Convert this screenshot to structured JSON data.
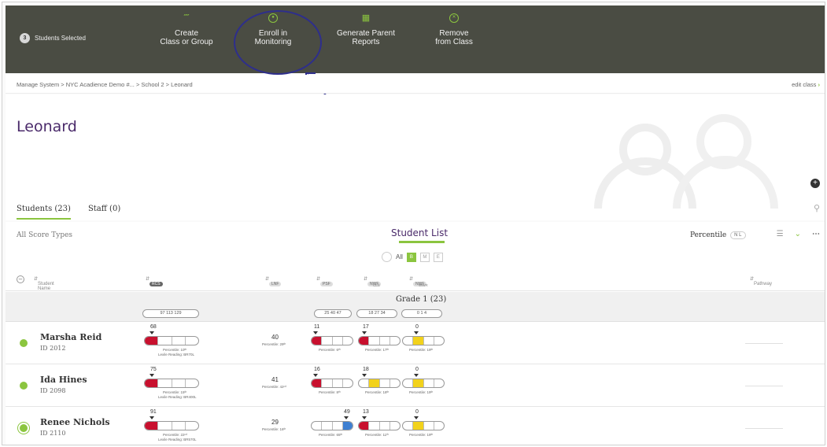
{
  "actionbar": {
    "selected_count": "3",
    "selected_label": "Students Selected",
    "actions": [
      {
        "line1": "Create",
        "line2": "Class or Group",
        "icon": "group-icon"
      },
      {
        "line1": "Enroll in",
        "line2": "Monitoring",
        "icon": "monitoring-icon"
      },
      {
        "line1": "Generate Parent",
        "line2": "Reports",
        "icon": "document-icon"
      },
      {
        "line1": "Remove",
        "line2": "from Class",
        "icon": "remove-icon"
      }
    ]
  },
  "breadcrumb": "Manage System > NYC Acadience Demo #... > School 2 > Leonard",
  "edit_class": "edit class",
  "page_title": "Leonard",
  "tabs": [
    {
      "label": "Students (23)",
      "active": true
    },
    {
      "label": "Staff (0)",
      "active": false
    }
  ],
  "list": {
    "score_types": "All Score Types",
    "title": "Student List",
    "percentile_label": "Percentile",
    "percentile_opts": "N L",
    "filter_all": "All",
    "filter_opts": [
      "B",
      "M",
      "E"
    ]
  },
  "columns": {
    "student_name": "Student Name",
    "c1": "RCS",
    "c2": "LNF",
    "c3": "PSF",
    "c4": "NWF",
    "c4_sub": "CLS",
    "c5": "NWF",
    "c5_sub": "WWR",
    "pathway": "Pathway"
  },
  "grade": {
    "title": "Grade 1 (23)",
    "ranges": [
      "97  113  129",
      "25  40  47",
      "18  27  34",
      "0  1  4"
    ]
  },
  "students": [
    {
      "name": "Marsha Reid",
      "id": "ID 2012",
      "composite": "68",
      "composite_level": 1,
      "composite_pct": "Percentile: 10ᵗʰ",
      "lexile": "Lexile Reading: BR70L",
      "lnf": "40",
      "lnf_pct": "Percentile: 29ᵗʰ",
      "psf": "11",
      "psf_level": 1,
      "psf_pct": "Percentile: 6ᵗʰ",
      "cls": "17",
      "cls_level": 1,
      "cls_pct": "Percentile: 17ᵗʰ",
      "wwr": "0",
      "wwr_level": 2,
      "wwr_pct": "Percentile: 19ᵗʰ"
    },
    {
      "name": "Ida Hines",
      "id": "ID 2098",
      "composite": "75",
      "composite_level": 1,
      "composite_pct": "Percentile: 15ᵗʰ",
      "lexile": "Lexile Reading: BR400L",
      "lnf": "41",
      "lnf_pct": "Percentile: 42ⁿᵈ",
      "psf": "16",
      "psf_level": 1,
      "psf_pct": "Percentile: 8ᵗʰ",
      "cls": "18",
      "cls_level": 2,
      "cls_pct": "Percentile: 18ᵗʰ",
      "wwr": "0",
      "wwr_level": 2,
      "wwr_pct": "Percentile: 19ᵗʰ"
    },
    {
      "name": "Renee Nichols",
      "id": "ID 2110",
      "composite": "91",
      "composite_level": 1,
      "composite_pct": "Percentile: 22ⁿᵈ",
      "lexile": "Lexile Reading: BR570L",
      "lnf": "29",
      "lnf_pct": "Percentile: 16ᵗʰ",
      "psf": "49",
      "psf_level": 4,
      "psf_pct": "Percentile: 65ᵗʰ",
      "cls": "13",
      "cls_level": 1,
      "cls_pct": "Percentile: 11ᵗʰ",
      "wwr": "0",
      "wwr_level": 2,
      "wwr_pct": "Percentile: 19ᵗʰ"
    }
  ],
  "colors": {
    "accent": "#8bc53f",
    "bar": "#4a4c43",
    "title": "#4a2a6a",
    "red": "#c8102e",
    "yellow": "#f2d21b",
    "blue": "#3d7fd1"
  }
}
